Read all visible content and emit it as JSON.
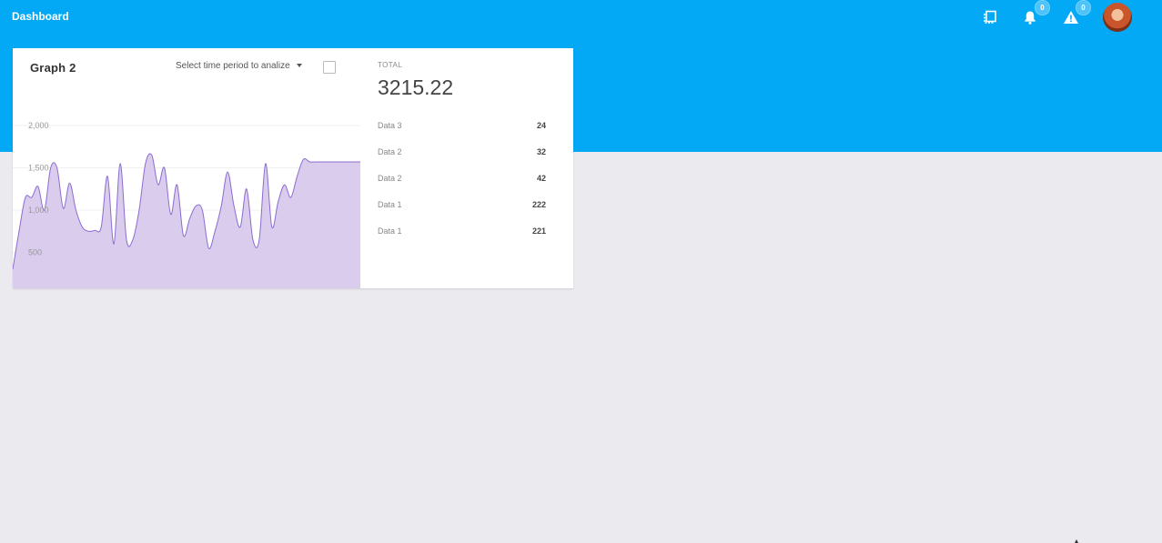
{
  "header": {
    "title": "Dashboard",
    "icons": [
      {
        "name": "pages-icon",
        "badge": null
      },
      {
        "name": "bell-icon",
        "badge": "0"
      },
      {
        "name": "warning-icon",
        "badge": "0"
      }
    ],
    "color": "#03a9f4"
  },
  "card": {
    "title": "Graph 2",
    "period_select": "Select time period to analize",
    "total_label": "TOTAL",
    "total_value": "3215.22",
    "rows": [
      {
        "label": "Data 3",
        "value": "24"
      },
      {
        "label": "Data 2",
        "value": "32"
      },
      {
        "label": "Data 2",
        "value": "42"
      },
      {
        "label": "Data 1",
        "value": "222"
      },
      {
        "label": "Data 1",
        "value": "221"
      }
    ]
  },
  "chart_data": {
    "type": "area",
    "title": "",
    "xlabel": "",
    "ylabel": "",
    "y_ticks": [
      "500",
      "1,000",
      "1,500",
      "2,000"
    ],
    "y_tick_values": [
      500,
      1000,
      1500,
      2000
    ],
    "ylim": [
      0,
      2200
    ],
    "grid": true,
    "fill_color": "#d9cced",
    "line_color": "#8a6ccf",
    "x": [
      0,
      1,
      2,
      3,
      4,
      5,
      6,
      7,
      8,
      9,
      10,
      11,
      12,
      13,
      14,
      15,
      16,
      17,
      18,
      19,
      20,
      21,
      22,
      23,
      24,
      25,
      26,
      27,
      28,
      29,
      30,
      31,
      32,
      33,
      34,
      35,
      36,
      37,
      38,
      39,
      40,
      41,
      42,
      43,
      44,
      45,
      46,
      47,
      48,
      49,
      50,
      51,
      52,
      53,
      54,
      55
    ],
    "values": [
      300,
      750,
      1150,
      1150,
      1280,
      1000,
      1500,
      1500,
      1020,
      1320,
      1000,
      800,
      750,
      760,
      800,
      1400,
      600,
      1550,
      650,
      650,
      1000,
      1550,
      1650,
      1300,
      1500,
      950,
      1300,
      700,
      900,
      1050,
      1000,
      550,
      750,
      1050,
      1450,
      1050,
      800,
      1250,
      650,
      650,
      1550,
      800,
      1100,
      1300,
      1150,
      1400,
      1600,
      1570,
      1570,
      1570,
      1570,
      1570,
      1570,
      1570,
      1570,
      1570
    ]
  }
}
